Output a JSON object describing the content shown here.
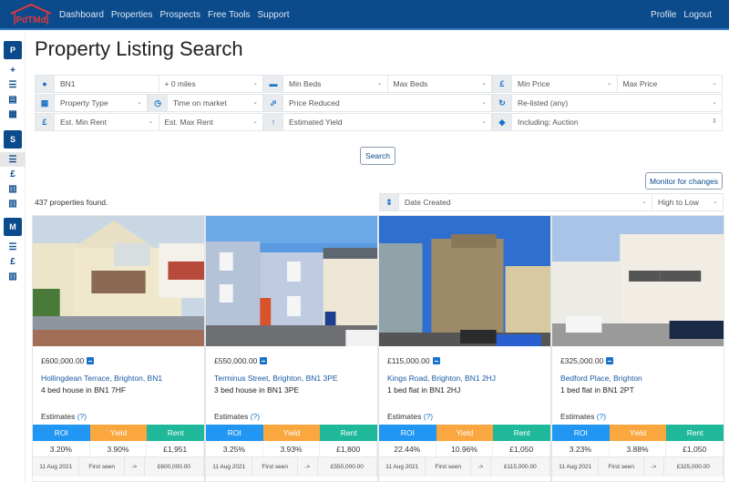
{
  "nav": {
    "logo_text": "PdTMd",
    "links": [
      "Dashboard",
      "Properties",
      "Prospects",
      "Free Tools",
      "Support"
    ],
    "right_links": [
      "Profile",
      "Logout"
    ]
  },
  "sidebar": {
    "sections": [
      {
        "badge": "P",
        "icons": [
          "plus-icon",
          "list-icon",
          "calculator-icon",
          "calendar-icon"
        ]
      },
      {
        "badge": "S",
        "icons": [
          "list-icon",
          "pound-icon",
          "map-icon",
          "map-icon"
        ]
      },
      {
        "badge": "M",
        "icons": [
          "list-icon",
          "pound-icon",
          "map-icon"
        ]
      }
    ]
  },
  "page": {
    "title": "Property Listing Search"
  },
  "filters": {
    "location": "BN1",
    "radius": "+ 0 miles",
    "min_beds": "Min Beds",
    "max_beds": "Max Beds",
    "min_price": "Min Price",
    "max_price": "Max Price",
    "property_type": "Property Type",
    "time_on_market": "Time on market",
    "price_reduced": "Price Reduced",
    "relisted": "Re-listed (any)",
    "min_rent": "Est. Min Rent",
    "max_rent": "Est. Max Rent",
    "yield": "Estimated Yield",
    "including": "Including: Auction"
  },
  "actions": {
    "search": "Search",
    "monitor": "Monitor for changes"
  },
  "results": {
    "count_text": "437 properties found."
  },
  "sort": {
    "field": "Date Created",
    "order": "High to Low"
  },
  "estimate_labels": {
    "estimates": "Estimates",
    "help": "(?)",
    "roi": "ROI",
    "yield": "Yield",
    "rent": "Rent"
  },
  "colors": {
    "roi": "#2196f3",
    "yield": "#f9a73e",
    "rent": "#1fb89a",
    "nav": "#0b4a8b"
  },
  "listings": [
    {
      "price": "£600,000.00",
      "address": "Hollingdean Terrace, Brighton, BN1",
      "description": "4 bed house in BN1 7HF",
      "roi": "3.20%",
      "yield": "3.90%",
      "rent": "£1,951",
      "history": {
        "date": "11 Aug 2021",
        "event": "First seen",
        "arrow": "->",
        "value": "£600,000.00"
      }
    },
    {
      "price": "£550,000.00",
      "address": "Terminus Street, Brighton, BN1 3PE",
      "description": "3 bed house in BN1 3PE",
      "roi": "3.25%",
      "yield": "3.93%",
      "rent": "£1,800",
      "history": {
        "date": "11 Aug 2021",
        "event": "First seen",
        "arrow": "->",
        "value": "£550,000.00"
      }
    },
    {
      "price": "£115,000.00",
      "address": "Kings Road, Brighton, BN1 2HJ",
      "description": "1 bed flat in BN1 2HJ",
      "roi": "22.44%",
      "yield": "10.96%",
      "rent": "£1,050",
      "history": {
        "date": "11 Aug 2021",
        "event": "First seen",
        "arrow": "->",
        "value": "£115,000.00"
      }
    },
    {
      "price": "£325,000.00",
      "address": "Bedford Place, Brighton",
      "description": "1 bed flat in BN1 2PT",
      "roi": "3.23%",
      "yield": "3.88%",
      "rent": "£1,050",
      "history": {
        "date": "11 Aug 2021",
        "event": "First seen",
        "arrow": "->",
        "value": "£325,000.00"
      }
    }
  ]
}
